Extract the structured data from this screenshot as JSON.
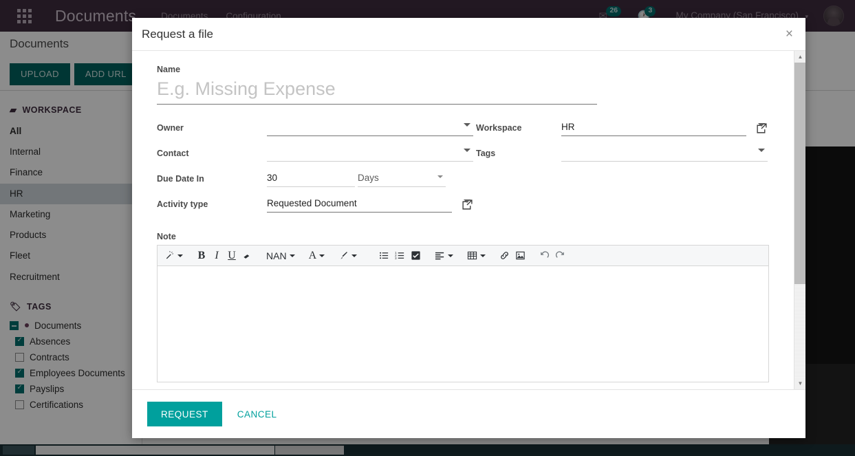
{
  "navbar": {
    "apps_icon": "apps-grid-icon",
    "brand": "Documents",
    "menu": [
      "Documents",
      "Configuration"
    ],
    "messages_badge": "26",
    "activities_badge": "3",
    "company": "My Company (San Francisco)",
    "caret": "▾"
  },
  "breadcrumb": {
    "title": "Documents"
  },
  "control_panel": {
    "buttons": [
      "UPLOAD",
      "ADD URL"
    ]
  },
  "sidebar": {
    "workspace_header": "WORKSPACE",
    "workspace_items": [
      {
        "label": "All",
        "bold": true,
        "active": false
      },
      {
        "label": "Internal",
        "bold": false,
        "active": false
      },
      {
        "label": "Finance",
        "bold": false,
        "active": false
      },
      {
        "label": "HR",
        "bold": false,
        "active": true
      },
      {
        "label": "Marketing",
        "bold": false,
        "active": false
      },
      {
        "label": "Products",
        "bold": false,
        "active": false
      },
      {
        "label": "Fleet",
        "bold": false,
        "active": false
      },
      {
        "label": "Recruitment",
        "bold": false,
        "active": false
      }
    ],
    "tags_header": "TAGS",
    "tags": [
      {
        "label": "Documents",
        "state": "indeterminate",
        "dot": true
      },
      {
        "label": "Absences",
        "state": "checked",
        "dot": false
      },
      {
        "label": "Contracts",
        "state": "unchecked",
        "dot": false
      },
      {
        "label": "Employees Documents",
        "state": "checked",
        "dot": false
      },
      {
        "label": "Payslips",
        "state": "checked",
        "dot": false
      },
      {
        "label": "Certifications",
        "state": "unchecked",
        "dot": false
      }
    ]
  },
  "modal": {
    "title": "Request a file",
    "close_label": "×",
    "name": {
      "label": "Name",
      "value": "",
      "placeholder": "E.g. Missing Expense"
    },
    "fields": {
      "owner": {
        "label": "Owner",
        "value": ""
      },
      "contact": {
        "label": "Contact",
        "value": ""
      },
      "due_date_in": {
        "label": "Due Date In",
        "value": "30",
        "unit": "Days"
      },
      "activity_type": {
        "label": "Activity type",
        "value": "Requested Document"
      },
      "workspace": {
        "label": "Workspace",
        "value": "HR"
      },
      "tags": {
        "label": "Tags",
        "value": ""
      }
    },
    "note": {
      "label": "Note",
      "content": "",
      "toolbar": [
        {
          "name": "style-magic-wand-icon",
          "label": "",
          "caret": true
        },
        {
          "name": "bold-icon",
          "label": "B",
          "caret": false
        },
        {
          "name": "italic-icon",
          "label": "I",
          "caret": false
        },
        {
          "name": "underline-icon",
          "label": "U",
          "caret": false
        },
        {
          "name": "eraser-icon",
          "label": "",
          "caret": false
        },
        {
          "name": "font-size-select",
          "label": "NAN",
          "caret": true
        },
        {
          "name": "font-color-icon",
          "label": "A",
          "caret": true
        },
        {
          "name": "background-color-brush-icon",
          "label": "",
          "caret": true
        },
        {
          "name": "unordered-list-icon",
          "label": "",
          "caret": false
        },
        {
          "name": "ordered-list-icon",
          "label": "",
          "caret": false
        },
        {
          "name": "checklist-icon",
          "label": "",
          "caret": false
        },
        {
          "name": "align-left-icon",
          "label": "",
          "caret": true
        },
        {
          "name": "table-icon",
          "label": "",
          "caret": true
        },
        {
          "name": "link-icon",
          "label": "",
          "caret": false
        },
        {
          "name": "image-icon",
          "label": "",
          "caret": false
        },
        {
          "name": "undo-icon",
          "label": "",
          "caret": false
        },
        {
          "name": "redo-icon",
          "label": "",
          "caret": false
        }
      ]
    },
    "footer": {
      "request_label": "REQUEST",
      "cancel_label": "CANCEL"
    }
  },
  "colors": {
    "navbar_bg": "#3f2c3f",
    "primary_teal": "#00a09d",
    "control_btn": "#00635f",
    "tag_checked": "#00706e",
    "active_row": "#cfd8dc"
  }
}
